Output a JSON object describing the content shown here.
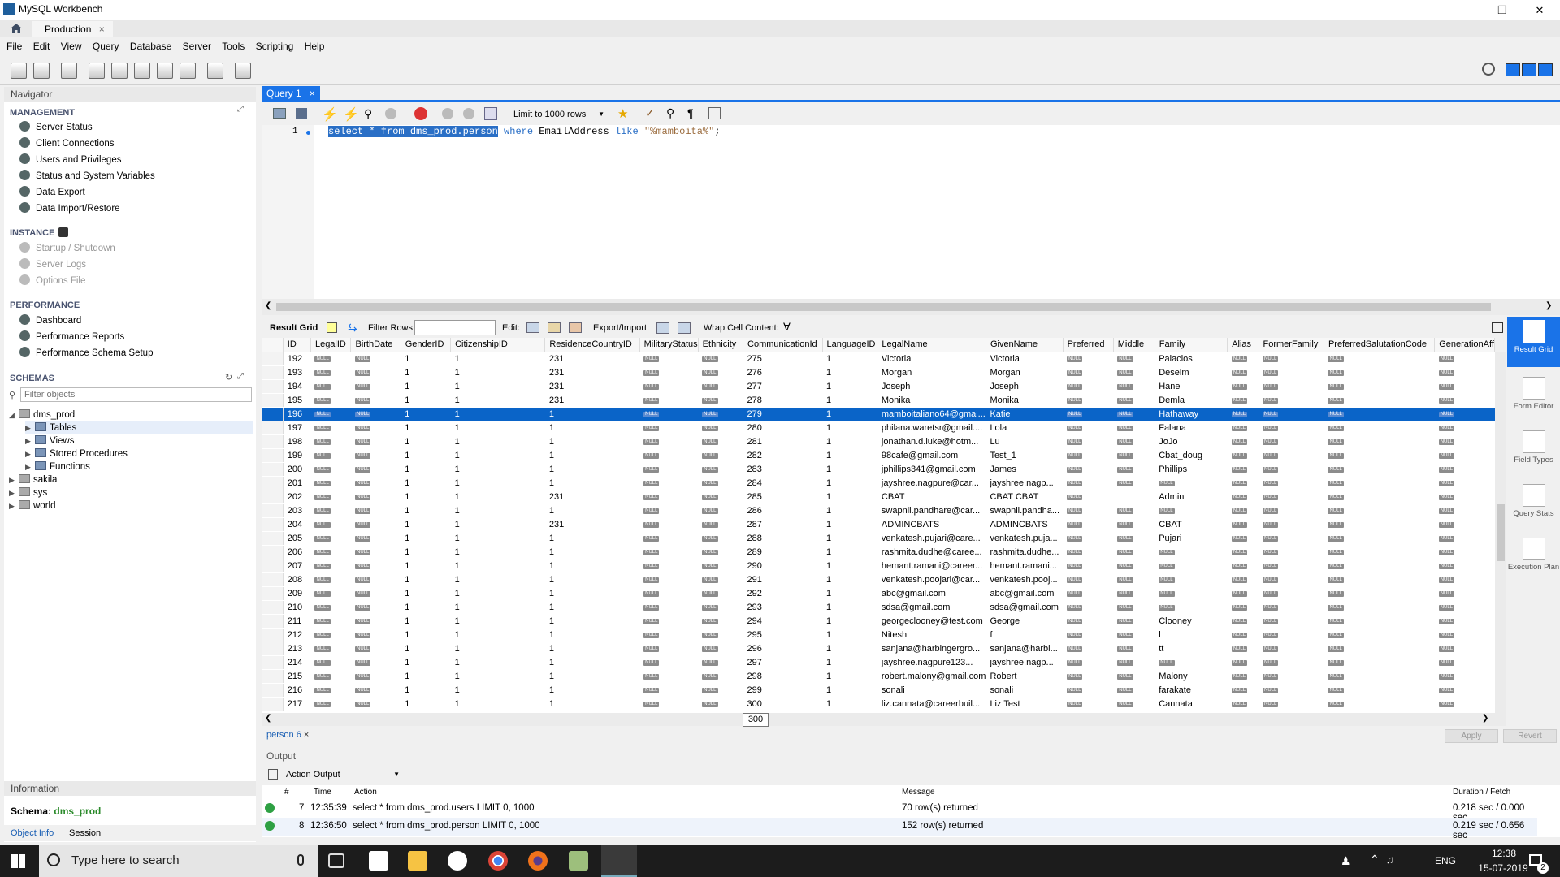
{
  "app": {
    "title": "MySQL Workbench",
    "connection_tab": "Production"
  },
  "menu": [
    "File",
    "Edit",
    "View",
    "Query",
    "Database",
    "Server",
    "Tools",
    "Scripting",
    "Help"
  ],
  "navigator": {
    "title": "Navigator",
    "management_title": "MANAGEMENT",
    "management": [
      "Server Status",
      "Client Connections",
      "Users and Privileges",
      "Status and System Variables",
      "Data Export",
      "Data Import/Restore"
    ],
    "instance_title": "INSTANCE",
    "instance": [
      "Startup / Shutdown",
      "Server Logs",
      "Options File"
    ],
    "performance_title": "PERFORMANCE",
    "performance": [
      "Dashboard",
      "Performance Reports",
      "Performance Schema Setup"
    ],
    "schemas_title": "SCHEMAS",
    "filter_placeholder": "Filter objects",
    "tree": {
      "db": "dms_prod",
      "children": [
        "Tables",
        "Views",
        "Stored Procedures",
        "Functions"
      ],
      "others": [
        "sakila",
        "sys",
        "world"
      ]
    }
  },
  "info": {
    "title": "Information",
    "schema_label": "Schema:",
    "schema_value": "dms_prod",
    "tab_object": "Object Info",
    "tab_session": "Session"
  },
  "editor": {
    "tab": "Query 1",
    "limit": "Limit to 1000 rows",
    "line_no": "1",
    "sql_selected": "select * from dms_prod.person",
    "sql_where": "where",
    "sql_col": " EmailAddress ",
    "sql_like": "like",
    "sql_str": "\"%mamboita%\"",
    "sql_end": ";"
  },
  "result_toolbar": {
    "grid": "Result Grid",
    "filter": "Filter Rows:",
    "edit": "Edit:",
    "export": "Export/Import:",
    "wrap": "Wrap Cell Content:"
  },
  "columns": [
    "ID",
    "LegalID",
    "BirthDate",
    "GenderID",
    "CitizenshipID",
    "ResidenceCountryID",
    "MilitaryStatus",
    "Ethnicity",
    "CommunicationId",
    "LanguageID",
    "LegalName",
    "GivenName",
    "Preferred",
    "Middle",
    "Family",
    "Alias",
    "FormerFamily",
    "PreferredSalutationCode",
    "GenerationAff"
  ],
  "null_label": "NULL",
  "rows": [
    [
      "192",
      "N",
      "N",
      "1",
      "1",
      "231",
      "N",
      "N",
      "275",
      "1",
      "Victoria",
      "Victoria",
      "N",
      "N",
      "Palacios",
      "N",
      "N",
      "N",
      "N"
    ],
    [
      "193",
      "N",
      "N",
      "1",
      "1",
      "231",
      "N",
      "N",
      "276",
      "1",
      "Morgan",
      "Morgan",
      "N",
      "N",
      "Deselm",
      "N",
      "N",
      "N",
      "N"
    ],
    [
      "194",
      "N",
      "N",
      "1",
      "1",
      "231",
      "N",
      "N",
      "277",
      "1",
      "Joseph",
      "Joseph",
      "N",
      "N",
      "Hane",
      "N",
      "N",
      "N",
      "N"
    ],
    [
      "195",
      "N",
      "N",
      "1",
      "1",
      "231",
      "N",
      "N",
      "278",
      "1",
      "Monika",
      "Monika",
      "N",
      "N",
      "Demla",
      "N",
      "N",
      "N",
      "N"
    ],
    [
      "196",
      "N",
      "N",
      "1",
      "1",
      "1",
      "N",
      "N",
      "279",
      "1",
      "mamboitaliano64@gmai...",
      "Katie",
      "N",
      "N",
      "Hathaway",
      "N",
      "N",
      "N",
      "N"
    ],
    [
      "197",
      "N",
      "N",
      "1",
      "1",
      "1",
      "N",
      "N",
      "280",
      "1",
      "philana.waretsr@gmail....",
      "Lola",
      "N",
      "N",
      "Falana",
      "N",
      "N",
      "N",
      "N"
    ],
    [
      "198",
      "N",
      "N",
      "1",
      "1",
      "1",
      "N",
      "N",
      "281",
      "1",
      "jonathan.d.luke@hotm...",
      "Lu",
      "N",
      "N",
      "JoJo",
      "N",
      "N",
      "N",
      "N"
    ],
    [
      "199",
      "N",
      "N",
      "1",
      "1",
      "1",
      "N",
      "N",
      "282",
      "1",
      "98cafe@gmail.com",
      "Test_1",
      "N",
      "N",
      "Cbat_doug",
      "N",
      "N",
      "N",
      "N"
    ],
    [
      "200",
      "N",
      "N",
      "1",
      "1",
      "1",
      "N",
      "N",
      "283",
      "1",
      "jphillips341@gmail.com",
      "James",
      "N",
      "N",
      "Phillips",
      "N",
      "N",
      "N",
      "N"
    ],
    [
      "201",
      "N",
      "N",
      "1",
      "1",
      "1",
      "N",
      "N",
      "284",
      "1",
      "jayshree.nagpure@car...",
      "jayshree.nagp...",
      "N",
      "N",
      "N",
      "N",
      "N",
      "N",
      "N"
    ],
    [
      "202",
      "N",
      "N",
      "1",
      "1",
      "231",
      "N",
      "N",
      "285",
      "1",
      "CBAT",
      "CBAT CBAT",
      "N",
      "",
      "Admin",
      "N",
      "N",
      "N",
      "N"
    ],
    [
      "203",
      "N",
      "N",
      "1",
      "1",
      "1",
      "N",
      "N",
      "286",
      "1",
      "swapnil.pandhare@car...",
      "swapnil.pandha...",
      "N",
      "N",
      "N",
      "N",
      "N",
      "N",
      "N"
    ],
    [
      "204",
      "N",
      "N",
      "1",
      "1",
      "231",
      "N",
      "N",
      "287",
      "1",
      "ADMINCBATS",
      "ADMINCBATS",
      "N",
      "N",
      "CBAT",
      "N",
      "N",
      "N",
      "N"
    ],
    [
      "205",
      "N",
      "N",
      "1",
      "1",
      "1",
      "N",
      "N",
      "288",
      "1",
      "venkatesh.pujari@care...",
      "venkatesh.puja...",
      "N",
      "N",
      "Pujari",
      "N",
      "N",
      "N",
      "N"
    ],
    [
      "206",
      "N",
      "N",
      "1",
      "1",
      "1",
      "N",
      "N",
      "289",
      "1",
      "rashmita.dudhe@caree...",
      "rashmita.dudhe...",
      "N",
      "N",
      "N",
      "N",
      "N",
      "N",
      "N"
    ],
    [
      "207",
      "N",
      "N",
      "1",
      "1",
      "1",
      "N",
      "N",
      "290",
      "1",
      "hemant.ramani@career...",
      "hemant.ramani...",
      "N",
      "N",
      "N",
      "N",
      "N",
      "N",
      "N"
    ],
    [
      "208",
      "N",
      "N",
      "1",
      "1",
      "1",
      "N",
      "N",
      "291",
      "1",
      "venkatesh.poojari@car...",
      "venkatesh.pooj...",
      "N",
      "N",
      "N",
      "N",
      "N",
      "N",
      "N"
    ],
    [
      "209",
      "N",
      "N",
      "1",
      "1",
      "1",
      "N",
      "N",
      "292",
      "1",
      "abc@gmail.com",
      "abc@gmail.com",
      "N",
      "N",
      "N",
      "N",
      "N",
      "N",
      "N"
    ],
    [
      "210",
      "N",
      "N",
      "1",
      "1",
      "1",
      "N",
      "N",
      "293",
      "1",
      "sdsa@gmail.com",
      "sdsa@gmail.com",
      "N",
      "N",
      "N",
      "N",
      "N",
      "N",
      "N"
    ],
    [
      "211",
      "N",
      "N",
      "1",
      "1",
      "1",
      "N",
      "N",
      "294",
      "1",
      "georgeclooney@test.com",
      "George",
      "N",
      "N",
      "Clooney",
      "N",
      "N",
      "N",
      "N"
    ],
    [
      "212",
      "N",
      "N",
      "1",
      "1",
      "1",
      "N",
      "N",
      "295",
      "1",
      "Nitesh",
      "f",
      "N",
      "N",
      "l",
      "N",
      "N",
      "N",
      "N"
    ],
    [
      "213",
      "N",
      "N",
      "1",
      "1",
      "1",
      "N",
      "N",
      "296",
      "1",
      "sanjana@harbingergro...",
      "sanjana@harbi...",
      "N",
      "N",
      "tt",
      "N",
      "N",
      "N",
      "N"
    ],
    [
      "214",
      "N",
      "N",
      "1",
      "1",
      "1",
      "N",
      "N",
      "297",
      "1",
      "jayshree.nagpure123...",
      "jayshree.nagp...",
      "N",
      "N",
      "N",
      "N",
      "N",
      "N",
      "N"
    ],
    [
      "215",
      "N",
      "N",
      "1",
      "1",
      "1",
      "N",
      "N",
      "298",
      "1",
      "robert.malony@gmail.com",
      "Robert",
      "N",
      "N",
      "Malony",
      "N",
      "N",
      "N",
      "N"
    ],
    [
      "216",
      "N",
      "N",
      "1",
      "1",
      "1",
      "N",
      "N",
      "299",
      "1",
      "sonali",
      "sonali",
      "N",
      "N",
      "farakate",
      "N",
      "N",
      "N",
      "N"
    ],
    [
      "217",
      "N",
      "N",
      "1",
      "1",
      "1",
      "N",
      "N",
      "300",
      "1",
      "liz.cannata@careerbuil...",
      "Liz Test",
      "N",
      "N",
      "Cannata",
      "N",
      "N",
      "N",
      "N"
    ]
  ],
  "tooltip": "300",
  "result_tab": "person 6",
  "apply": "Apply",
  "revert": "Revert",
  "right_panel": [
    "Result Grid",
    "Form Editor",
    "Field Types",
    "Query Stats",
    "Execution Plan"
  ],
  "output": {
    "title": "Output",
    "mode": "Action Output",
    "headers": {
      "num": "#",
      "time": "Time",
      "action": "Action",
      "message": "Message",
      "duration": "Duration / Fetch"
    },
    "rows": [
      {
        "num": "7",
        "time": "12:35:39",
        "action": "select * from dms_prod.users LIMIT 0, 1000",
        "message": "70 row(s) returned",
        "duration": "0.218 sec / 0.000 sec"
      },
      {
        "num": "8",
        "time": "12:36:50",
        "action": "select * from dms_prod.person LIMIT 0, 1000",
        "message": "152 row(s) returned",
        "duration": "0.219 sec / 0.656 sec"
      }
    ]
  },
  "taskbar": {
    "search": "Type here to search",
    "lang": "ENG",
    "time": "12:38",
    "date": "15-07-2019",
    "badge": "2"
  }
}
